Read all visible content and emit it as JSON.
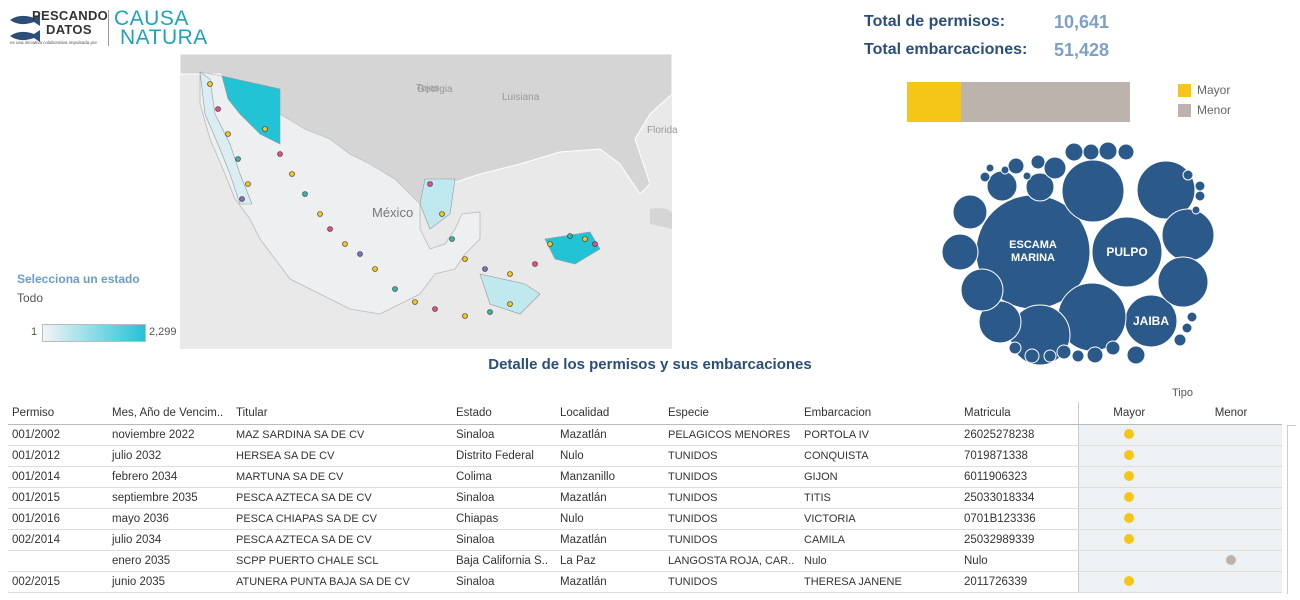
{
  "logo": {
    "line1": "PESCANDO",
    "line2": "DATOS",
    "tagline": "es una iniciativa colaborativa impulsada por",
    "partner_line1": "CAUSA",
    "partner_line2": "NATURA"
  },
  "map": {
    "labels": [
      "Georgia",
      "Tejas",
      "Luisiana",
      "Florida",
      "México"
    ],
    "highlight_color": "#23c3d6"
  },
  "filter": {
    "label": "Selecciona un estado",
    "value": "Todo",
    "ramp_min": "1",
    "ramp_max": "2,299"
  },
  "totals": {
    "permits_label": "Total de permisos:",
    "permits_value": "10,641",
    "vessels_label": "Total embarcaciones:",
    "vessels_value": "51,428"
  },
  "tipo_bar": {
    "mayor_fraction": 0.24,
    "menor_fraction": 0.76,
    "mayor_color": "#f5c518",
    "menor_color": "#bcb3ac"
  },
  "legend": [
    {
      "label": "Mayor",
      "color": "#f5c518"
    },
    {
      "label": "Menor",
      "color": "#bcb3ac"
    }
  ],
  "bubbles": {
    "color": "#2b5a8a",
    "labels": [
      "ESCAMA",
      "MARINA",
      "PULPO",
      "JAIBA"
    ]
  },
  "table": {
    "title": "Detalle de los permisos y sus embarcaciones",
    "tipo_header": "Tipo",
    "columns": [
      "Permiso",
      "Mes, Año de Vencim..",
      "Titular",
      "Estado",
      "Localidad",
      "Especie",
      "Embarcacion",
      "Matricula",
      "Mayor",
      "Menor"
    ],
    "rows": [
      {
        "permiso": "001/2002",
        "mes": "noviembre 2022",
        "titular": "MAZ SARDINA SA DE CV",
        "estado": "Sinaloa",
        "localidad": "Mazatlán",
        "especie": "PELAGICOS MENORES",
        "embarcacion": "PORTOLA IV",
        "matricula": "26025278238",
        "tipo": "Mayor"
      },
      {
        "permiso": "001/2012",
        "mes": "julio 2032",
        "titular": "HERSEA SA DE CV",
        "estado": "Distrito Federal",
        "localidad": "Nulo",
        "especie": "TUNIDOS",
        "embarcacion": "CONQUISTA",
        "matricula": "7019871338",
        "tipo": "Mayor"
      },
      {
        "permiso": "001/2014",
        "mes": "febrero 2034",
        "titular": "MARTUNA SA DE CV",
        "estado": "Colima",
        "localidad": "Manzanillo",
        "especie": "TUNIDOS",
        "embarcacion": "GIJON",
        "matricula": "6011906323",
        "tipo": "Mayor"
      },
      {
        "permiso": "001/2015",
        "mes": "septiembre 2035",
        "titular": "PESCA AZTECA SA DE CV",
        "estado": "Sinaloa",
        "localidad": "Mazatlán",
        "especie": "TUNIDOS",
        "embarcacion": "TITIS",
        "matricula": "25033018334",
        "tipo": "Mayor"
      },
      {
        "permiso": "001/2016",
        "mes": "mayo 2036",
        "titular": "PESCA CHIAPAS SA DE CV",
        "estado": "Chiapas",
        "localidad": "Nulo",
        "especie": "TUNIDOS",
        "embarcacion": "VICTORIA",
        "matricula": "0701B123336",
        "tipo": "Mayor"
      },
      {
        "permiso": "002/2014",
        "mes": "julio 2034",
        "titular": "PESCA AZTECA SA DE CV",
        "estado": "Sinaloa",
        "localidad": "Mazatlán",
        "especie": "TUNIDOS",
        "embarcacion": "CAMILA",
        "matricula": "25032989339",
        "tipo": "Mayor"
      },
      {
        "permiso": "",
        "mes": "enero 2035",
        "titular": "SCPP PUERTO CHALE SCL",
        "estado": "Baja California S..",
        "localidad": "La Paz",
        "especie": " LANGOSTA ROJA, CAR..",
        "embarcacion": "Nulo",
        "matricula": "Nulo",
        "tipo": "Menor"
      },
      {
        "permiso": "002/2015",
        "mes": "junio 2035",
        "titular": "ATUNERA PUNTA BAJA SA DE CV",
        "estado": "Sinaloa",
        "localidad": "Mazatlán",
        "especie": "TUNIDOS",
        "embarcacion": "THERESA JANENE",
        "matricula": "2011726339",
        "tipo": "Mayor"
      }
    ]
  }
}
